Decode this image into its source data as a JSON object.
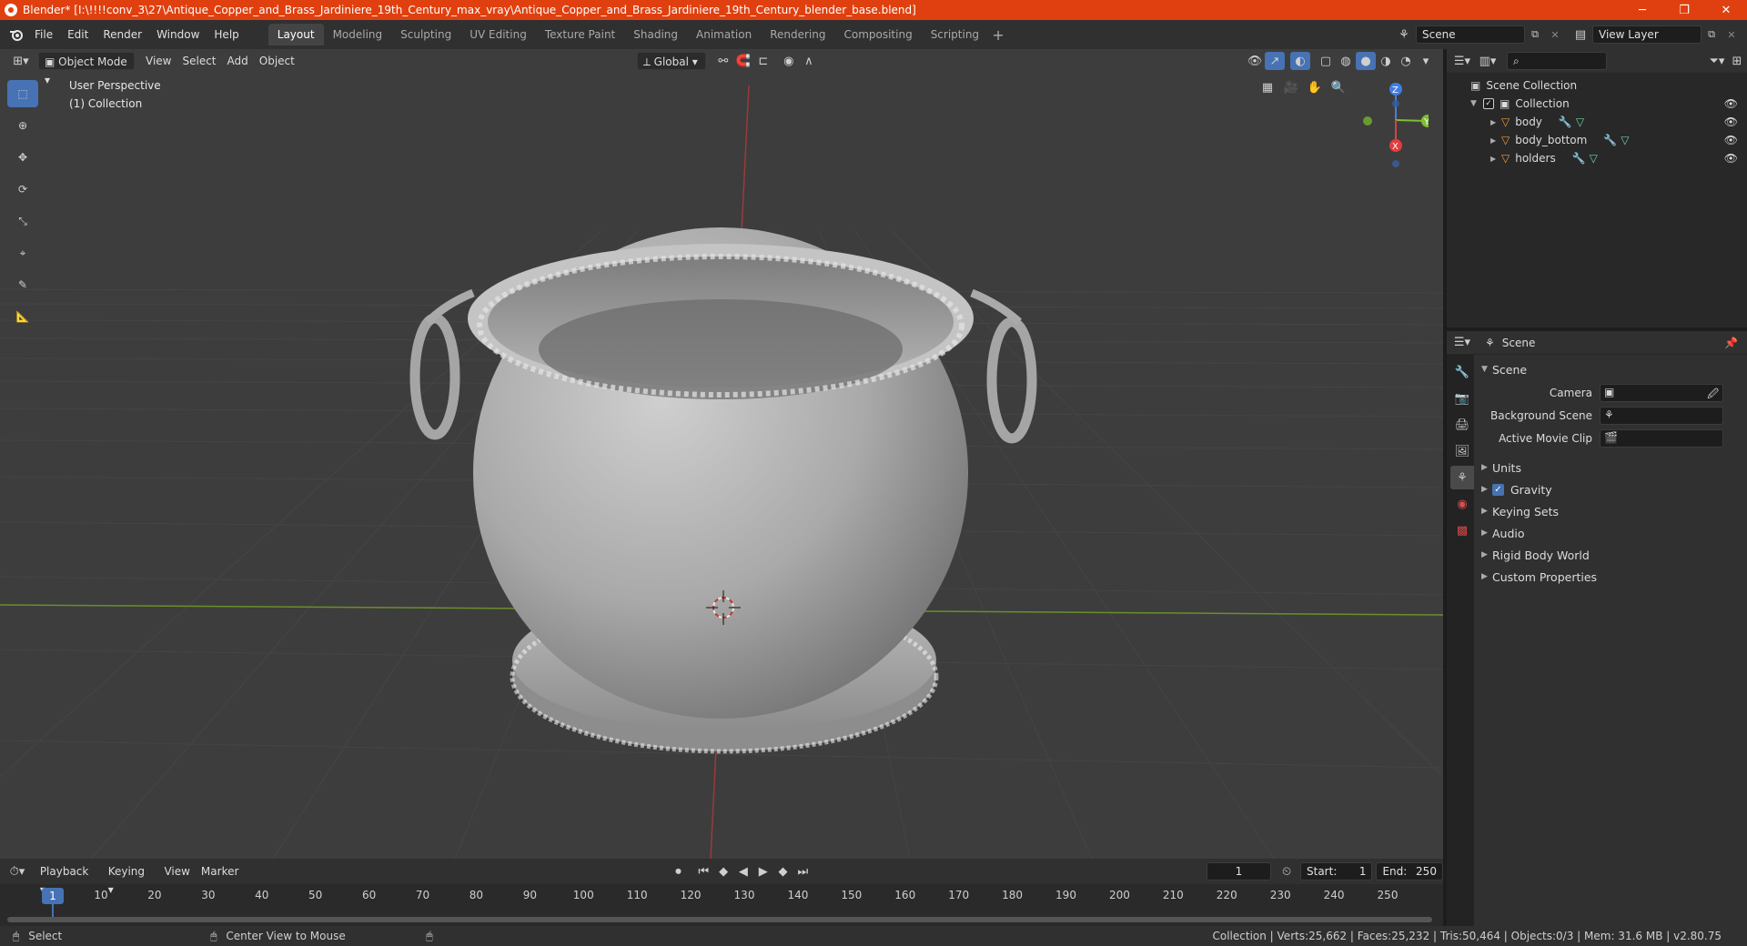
{
  "window": {
    "title": "Blender* [I:\\!!!!conv_3\\27\\Antique_Copper_and_Brass_Jardiniere_19th_Century_max_vray\\Antique_Copper_and_Brass_Jardiniere_19th_Century_blender_base.blend]"
  },
  "menu": [
    "File",
    "Edit",
    "Render",
    "Window",
    "Help"
  ],
  "workspaces": [
    "Layout",
    "Modeling",
    "Sculpting",
    "UV Editing",
    "Texture Paint",
    "Shading",
    "Animation",
    "Rendering",
    "Compositing",
    "Scripting"
  ],
  "active_workspace": "Layout",
  "scene_field": "Scene",
  "view_layer_field": "View Layer",
  "viewport": {
    "mode": "Object Mode",
    "menus": [
      "View",
      "Select",
      "Add",
      "Object"
    ],
    "orientation": "Global",
    "perspective_label": "User Perspective",
    "collection_label": "(1) Collection",
    "gizmo": {
      "x": "X",
      "y": "Y",
      "z": "Z"
    }
  },
  "outliner": {
    "root": "Scene Collection",
    "collection": "Collection",
    "objects": [
      "body",
      "body_bottom",
      "holders"
    ]
  },
  "properties": {
    "header": "Scene",
    "panel_title": "Scene",
    "fields": [
      {
        "label": "Camera"
      },
      {
        "label": "Background Scene"
      },
      {
        "label": "Active Movie Clip"
      }
    ],
    "sections": [
      "Units",
      "Gravity",
      "Keying Sets",
      "Audio",
      "Rigid Body World",
      "Custom Properties"
    ]
  },
  "timeline": {
    "menus": [
      "Playback",
      "Keying",
      "View",
      "Marker"
    ],
    "current_frame": "1",
    "start_label": "Start:",
    "start": "1",
    "end_label": "End:",
    "end": "250",
    "ticks": [
      "1",
      "10",
      "20",
      "30",
      "40",
      "50",
      "60",
      "70",
      "80",
      "90",
      "100",
      "110",
      "120",
      "130",
      "140",
      "150",
      "160",
      "170",
      "180",
      "190",
      "200",
      "210",
      "220",
      "230",
      "240",
      "250"
    ]
  },
  "statusbar": {
    "left1": "Select",
    "left2": "Center View to Mouse",
    "stats": "Collection | Verts:25,662 | Faces:25,232 | Tris:50,464 | Objects:0/3 | Mem: 31.6 MB | v2.80.75"
  },
  "colors": {
    "accent": "#4772b3",
    "titlebar": "#e0400f",
    "object_orange": "#e99b3e",
    "mesh_green": "#6fd0a0",
    "wrench_blue": "#6ba4e6"
  }
}
